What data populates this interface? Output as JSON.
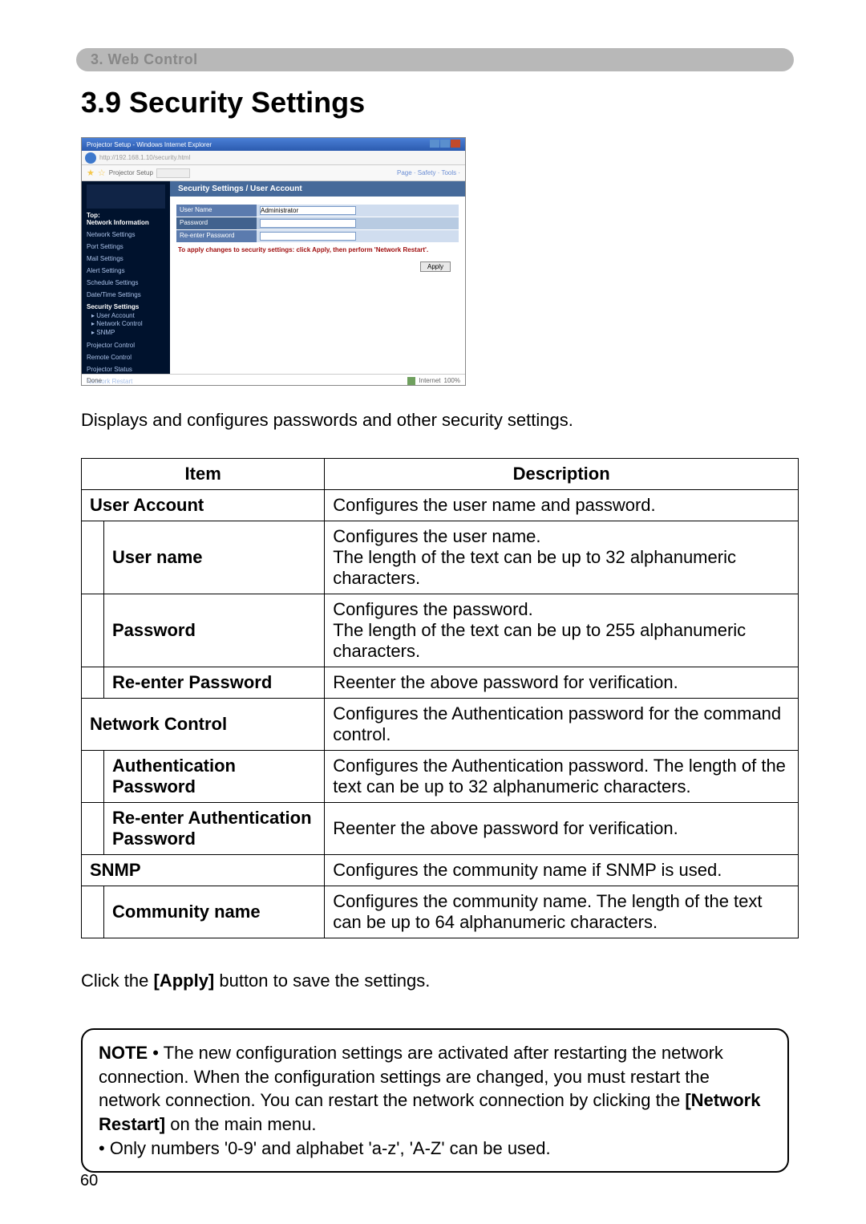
{
  "section_header": "3. Web Control",
  "title": "3.9 Security Settings",
  "intro": "Displays and configures passwords and other security settings.",
  "screenshot": {
    "window_title": "Projector Setup - Windows Internet Explorer",
    "address": "http://192.168.1.10/security.html",
    "site_label": "Projector Setup",
    "toolbar_links": "Page · Safety · Tools ·",
    "sidebar": {
      "top": "Top:",
      "net_info": "Network Information",
      "items": [
        "Network Settings",
        "Port Settings",
        "Mail Settings",
        "Alert Settings",
        "Schedule Settings",
        "Date/Time Settings"
      ],
      "security": "Security Settings",
      "security_sub": [
        "User Account",
        "Network Control",
        "SNMP"
      ],
      "tail": [
        "Projector Control",
        "Remote Control",
        "Projector Status",
        "Network Restart"
      ]
    },
    "panel_title": "Security Settings / User Account",
    "rows": {
      "user_name_label": "User Name",
      "user_name_value": "Administrator",
      "password_label": "Password",
      "reenter_label": "Re-enter Password"
    },
    "warn": "To apply changes to security settings: click Apply, then perform 'Network Restart'.",
    "apply_label": "Apply",
    "status_left": "Done",
    "status_right_a": "Internet",
    "status_right_b": "100%"
  },
  "table": {
    "header_item": "Item",
    "header_desc": "Description",
    "rows": [
      {
        "group": true,
        "item": "User Account",
        "desc": "Configures the user name and password."
      },
      {
        "group": false,
        "item": "User name",
        "desc": "Configures the user name.\nThe length of the text can be up to 32 alphanumeric characters."
      },
      {
        "group": false,
        "item": "Password",
        "desc": "Configures the password.\nThe length of the text can be up to 255 alphanumeric characters."
      },
      {
        "group": false,
        "item": "Re-enter Password",
        "desc": "Reenter the above password for verification."
      },
      {
        "group": true,
        "item": "Network Control",
        "desc": "Configures the Authentication password for the command control."
      },
      {
        "group": false,
        "item": "Authentication Password",
        "desc": "Configures the Authentication password. The length of the text can be up to 32 alphanumeric characters."
      },
      {
        "group": false,
        "item": "Re-enter Authentication Password",
        "desc": "Reenter the above password for verification."
      },
      {
        "group": true,
        "item": "SNMP",
        "desc": "Configures the community name if SNMP is used."
      },
      {
        "group": false,
        "item": "Community name",
        "desc": "Configures the community name. The length of the text can be up to 64 alphanumeric characters."
      }
    ]
  },
  "apply_note_pre": "Click the ",
  "apply_note_bold": "[Apply]",
  "apply_note_post": " button to save the settings.",
  "note": {
    "label": "NOTE",
    "bullet1_pre": " • The new configuration settings are activated after restarting the network connection. When the configuration settings are changed, you must restart the network connection. You can restart the network connection by clicking the ",
    "bullet1_bold": "[Network Restart]",
    "bullet1_post": " on the main menu.",
    "bullet2": "• Only numbers '0-9' and alphabet 'a-z', 'A-Z' can be used."
  },
  "page_number": "60"
}
